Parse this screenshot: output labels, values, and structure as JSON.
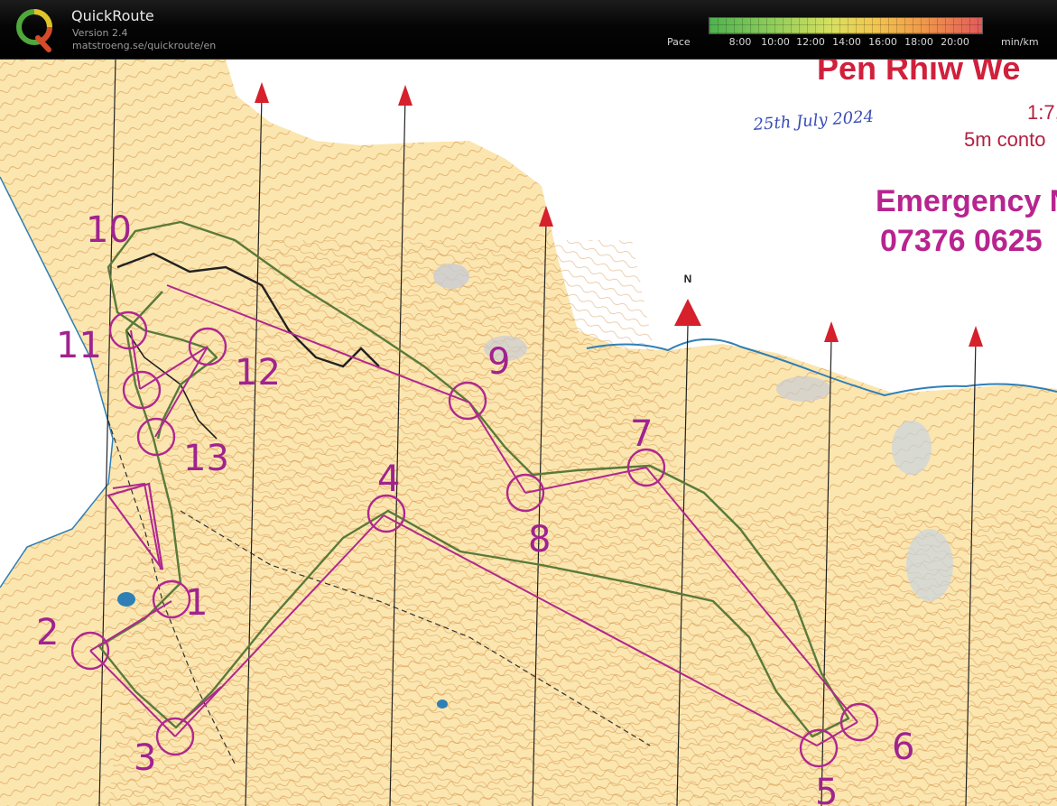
{
  "app": {
    "name": "QuickRoute",
    "version": "Version 2.4",
    "url": "matstroeng.se/quickroute/en"
  },
  "pace_scale": {
    "label": "Pace",
    "ticks": [
      "8:00",
      "10:00",
      "12:00",
      "14:00",
      "16:00",
      "18:00",
      "20:00"
    ],
    "unit": "min/km",
    "colors": {
      "fast": "#4fb24f",
      "mid": "#d8e060",
      "slow": "#e35a5a"
    }
  },
  "map": {
    "title": "Pen Rhiw We",
    "scale": "1:7,",
    "contour": "5m conto",
    "date_note": "25th July 2024",
    "emergency_label": "Emergency N",
    "emergency_phone": "07376 0625",
    "north_label": "N",
    "colors": {
      "course": "#b0288f",
      "route": "#5a7a3a",
      "paper": "#fbe9b8",
      "contour": "#d4893a"
    },
    "controls": [
      "1",
      "2",
      "3",
      "4",
      "5",
      "6",
      "7",
      "8",
      "9",
      "10",
      "11",
      "12",
      "13"
    ]
  }
}
